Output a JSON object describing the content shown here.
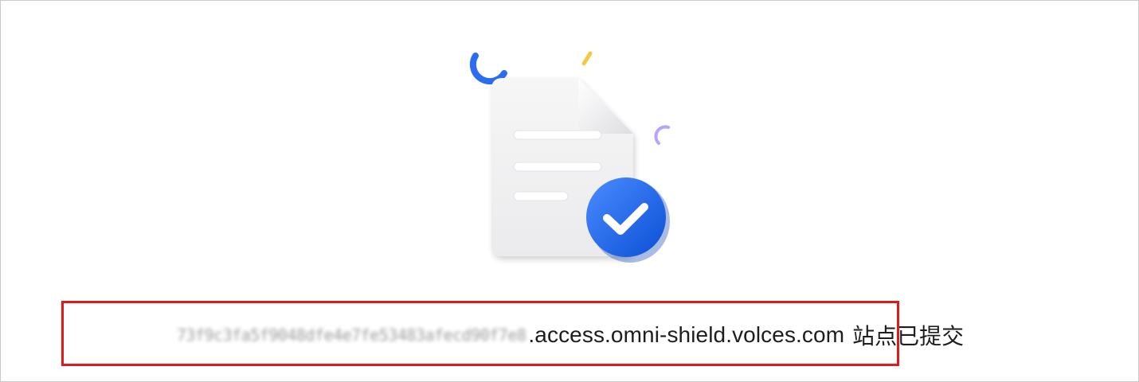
{
  "notice": {
    "site_prefix": "73f9c3fa5f9048dfe4e7fe53483afecd90f7e8",
    "site_domain": ".access.omni-shield.volces.com",
    "status_text": "站点已提交",
    "prefix_obscured": true
  },
  "icons": {
    "main": "document-check-icon",
    "decor": [
      "blue-arc-icon",
      "yellow-dash-icon",
      "purple-arc-icon"
    ]
  },
  "colors": {
    "check_badge": "#1a66f0",
    "highlight_border": "#e01a1a",
    "decor_blue": "#2a6cf2",
    "decor_yellow": "#f7c843",
    "decor_purple": "#b9a4f5"
  }
}
